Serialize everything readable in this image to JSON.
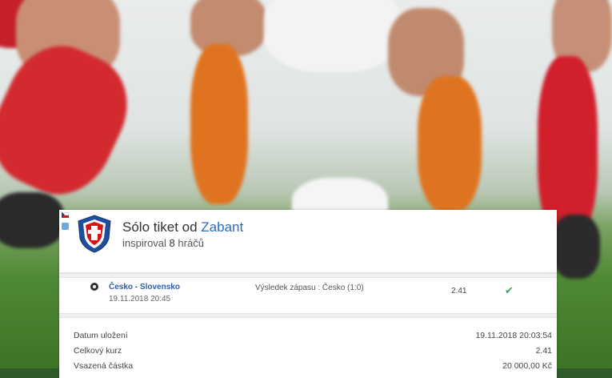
{
  "ticket": {
    "title_prefix": "Sólo tiket od",
    "author": "Zabant",
    "inspired_prefix": "inspiroval",
    "inspired_count": "8",
    "inspired_suffix": "hráčů"
  },
  "match": {
    "teams": "Česko - Slovensko",
    "datetime": "19.11.2018 20:45",
    "market": "Výsledek zápasu : Česko (1:0)",
    "odds": "2.41",
    "result_icon": "check-icon"
  },
  "summary": [
    {
      "label": "Datum uložení",
      "value": "19.11.2018 20:03:54"
    },
    {
      "label": "Celkový kurz",
      "value": "2.41"
    },
    {
      "label": "Vsazená částka",
      "value": "20 000,00 Kč"
    }
  ],
  "colors": {
    "author_link": "#2b6cb8",
    "team_link": "#2b5fa6",
    "success": "#3aa55b"
  }
}
